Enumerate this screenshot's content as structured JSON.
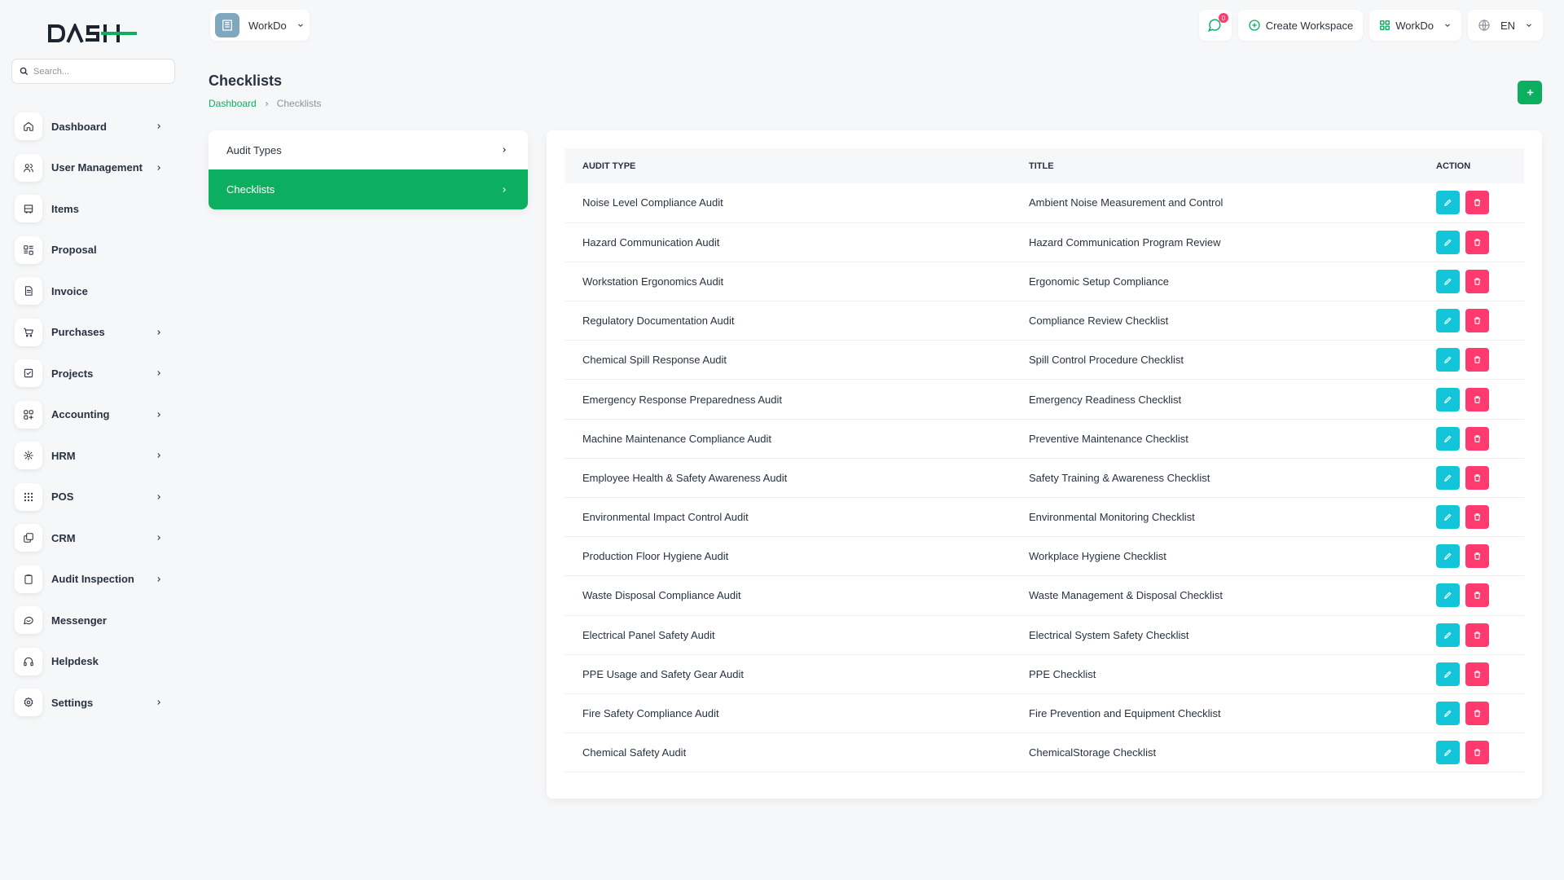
{
  "search": {
    "placeholder": "Search..."
  },
  "sidebar": {
    "items": [
      {
        "label": "Dashboard",
        "icon": "home-icon",
        "has_children": true
      },
      {
        "label": "User Management",
        "icon": "users-icon",
        "has_children": true
      },
      {
        "label": "Items",
        "icon": "cart-icon",
        "has_children": false
      },
      {
        "label": "Proposal",
        "icon": "proposal-icon",
        "has_children": false
      },
      {
        "label": "Invoice",
        "icon": "invoice-icon",
        "has_children": false
      },
      {
        "label": "Purchases",
        "icon": "shopping-cart-icon",
        "has_children": true
      },
      {
        "label": "Projects",
        "icon": "check-square-icon",
        "has_children": true
      },
      {
        "label": "Accounting",
        "icon": "grid-icon",
        "has_children": true
      },
      {
        "label": "HRM",
        "icon": "hrm-icon",
        "has_children": true
      },
      {
        "label": "POS",
        "icon": "dots-grid-icon",
        "has_children": true
      },
      {
        "label": "CRM",
        "icon": "layers-icon",
        "has_children": true
      },
      {
        "label": "Audit Inspection",
        "icon": "clipboard-icon",
        "has_children": true
      },
      {
        "label": "Messenger",
        "icon": "chat-icon",
        "has_children": false
      },
      {
        "label": "Helpdesk",
        "icon": "headset-icon",
        "has_children": false
      },
      {
        "label": "Settings",
        "icon": "gear-icon",
        "has_children": true
      }
    ]
  },
  "header": {
    "workspace": "WorkDo",
    "notification_count": "0",
    "create_workspace": "Create Workspace",
    "workspace_menu": "WorkDo",
    "language": "EN"
  },
  "page": {
    "title": "Checklists",
    "breadcrumb": {
      "home": "Dashboard",
      "current": "Checklists"
    }
  },
  "side_menu": {
    "items": [
      {
        "label": "Audit Types",
        "active": false
      },
      {
        "label": "Checklists",
        "active": true
      }
    ]
  },
  "table": {
    "headers": {
      "audit_type": "Audit Type",
      "title": "Title",
      "action": "Action"
    },
    "rows": [
      {
        "audit_type": "Noise Level Compliance Audit",
        "title": "Ambient Noise Measurement and Control"
      },
      {
        "audit_type": "Hazard Communication Audit",
        "title": "Hazard Communication Program Review"
      },
      {
        "audit_type": "Workstation Ergonomics Audit",
        "title": "Ergonomic Setup Compliance"
      },
      {
        "audit_type": "Regulatory Documentation Audit",
        "title": "Compliance Review Checklist"
      },
      {
        "audit_type": "Chemical Spill Response Audit",
        "title": "Spill Control Procedure Checklist"
      },
      {
        "audit_type": "Emergency Response Preparedness Audit",
        "title": "Emergency Readiness Checklist"
      },
      {
        "audit_type": "Machine Maintenance Compliance Audit",
        "title": "Preventive Maintenance Checklist"
      },
      {
        "audit_type": "Employee Health & Safety Awareness Audit",
        "title": "Safety Training & Awareness Checklist"
      },
      {
        "audit_type": "Environmental Impact Control Audit",
        "title": "Environmental Monitoring Checklist"
      },
      {
        "audit_type": "Production Floor Hygiene Audit",
        "title": "Workplace Hygiene Checklist"
      },
      {
        "audit_type": "Waste Disposal Compliance Audit",
        "title": "Waste Management & Disposal Checklist"
      },
      {
        "audit_type": "Electrical Panel Safety Audit",
        "title": "Electrical System Safety Checklist"
      },
      {
        "audit_type": "PPE Usage and Safety Gear Audit",
        "title": "PPE Checklist"
      },
      {
        "audit_type": "Fire Safety Compliance Audit",
        "title": "Fire Prevention and Equipment Checklist"
      },
      {
        "audit_type": "Chemical Safety Audit",
        "title": "ChemicalStorage Checklist"
      }
    ]
  },
  "colors": {
    "accent": "#0caf60",
    "edit": "#12c5d8",
    "delete": "#ff3a6e",
    "text": "#293240"
  }
}
